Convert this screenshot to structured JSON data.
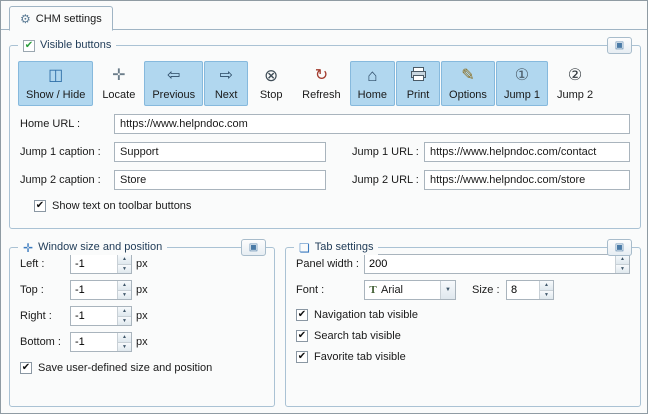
{
  "tab": {
    "label": "CHM settings"
  },
  "icons": {
    "tab": "⚙",
    "check_green": "✔",
    "check": "✔",
    "expand": "▣",
    "move": "✛",
    "page": "❏",
    "spin_up": "▲",
    "spin_down": "▼",
    "drop_down": "▼",
    "truetype": "T"
  },
  "groups": {
    "visible": {
      "title": "Visible buttons",
      "toolbar": [
        {
          "label": "Show / Hide",
          "icon": "panel-show-hide-icon",
          "glyph": "◫",
          "selected": true
        },
        {
          "label": "Locate",
          "icon": "locate-icon",
          "glyph": "✛",
          "selected": false
        },
        {
          "label": "Previous",
          "icon": "previous-arrow-icon",
          "glyph": "⇦",
          "selected": true
        },
        {
          "label": "Next",
          "icon": "next-arrow-icon",
          "glyph": "⇨",
          "selected": true
        },
        {
          "label": "Stop",
          "icon": "stop-icon",
          "glyph": "⊗",
          "selected": false
        },
        {
          "label": "Refresh",
          "icon": "refresh-icon",
          "glyph": "↻",
          "selected": false
        },
        {
          "label": "Home",
          "icon": "home-icon",
          "glyph": "⌂",
          "selected": true
        },
        {
          "label": "Print",
          "icon": "printer-icon",
          "selected": true
        },
        {
          "label": "Options",
          "icon": "options-pencil-icon",
          "glyph": "✎",
          "selected": true
        },
        {
          "label": "Jump 1",
          "icon": "jump1-icon",
          "glyph": "①",
          "selected": true
        },
        {
          "label": "Jump 2",
          "icon": "jump2-icon",
          "glyph": "②",
          "selected": false
        }
      ],
      "home_url": {
        "label": "Home URL :",
        "value": "https://www.helpndoc.com"
      },
      "jump1_caption": {
        "label": "Jump 1 caption :",
        "value": "Support"
      },
      "jump1_url": {
        "label": "Jump 1 URL :",
        "value": "https://www.helpndoc.com/contact"
      },
      "jump2_caption": {
        "label": "Jump 2 caption :",
        "value": "Store"
      },
      "jump2_url": {
        "label": "Jump 2 URL :",
        "value": "https://www.helpndoc.com/store"
      },
      "show_text": {
        "label": "Show text on toolbar buttons",
        "checked": true
      }
    },
    "window": {
      "title": "Window size and position",
      "fields": [
        {
          "label": "Left :",
          "value": "-1",
          "unit": "px"
        },
        {
          "label": "Top :",
          "value": "-1",
          "unit": "px"
        },
        {
          "label": "Right :",
          "value": "-1",
          "unit": "px"
        },
        {
          "label": "Bottom :",
          "value": "-1",
          "unit": "px"
        }
      ],
      "save": {
        "label": "Save user-defined size and position",
        "checked": true
      }
    },
    "tabset": {
      "title": "Tab settings",
      "panel_width": {
        "label": "Panel width :",
        "value": "200"
      },
      "font": {
        "label": "Font :",
        "value": "Arial"
      },
      "size": {
        "label": "Size :",
        "value": "8"
      },
      "checks": [
        {
          "label": "Navigation tab visible",
          "checked": true
        },
        {
          "label": "Search tab visible",
          "checked": true
        },
        {
          "label": "Favorite tab visible",
          "checked": true
        }
      ]
    }
  }
}
